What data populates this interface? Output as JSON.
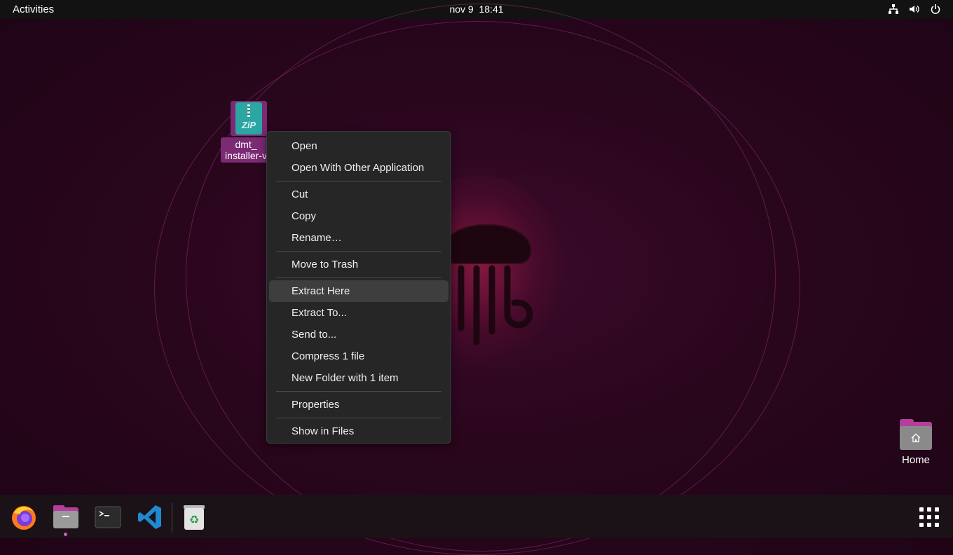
{
  "topbar": {
    "activities": "Activities",
    "date": "nov 9",
    "time": "18:41",
    "tray_icons": [
      "network-icon",
      "volume-icon",
      "power-icon"
    ]
  },
  "desktop": {
    "zip_file": {
      "icon_text": "ZiP",
      "label_line1": "dmt_",
      "label_line2": "installer-v"
    },
    "home_folder": {
      "label": "Home"
    }
  },
  "context_menu": {
    "items": [
      "Open",
      "Open With Other Application",
      "Cut",
      "Copy",
      "Rename…",
      "Move to Trash",
      "Extract Here",
      "Extract To...",
      "Send to...",
      "Compress 1 file",
      "New Folder with 1 item",
      "Properties",
      "Show in Files"
    ],
    "highlighted": "Extract Here"
  },
  "dock": {
    "apps": [
      "firefox-icon",
      "files-icon",
      "terminal-icon",
      "vscode-icon",
      "trash-icon"
    ],
    "show_apps": "apps-grid-icon"
  },
  "colors": {
    "accent": "#b33e9c",
    "selection": "#7b2a74",
    "menu_bg": "#262626",
    "topbar_bg": "#121212"
  }
}
